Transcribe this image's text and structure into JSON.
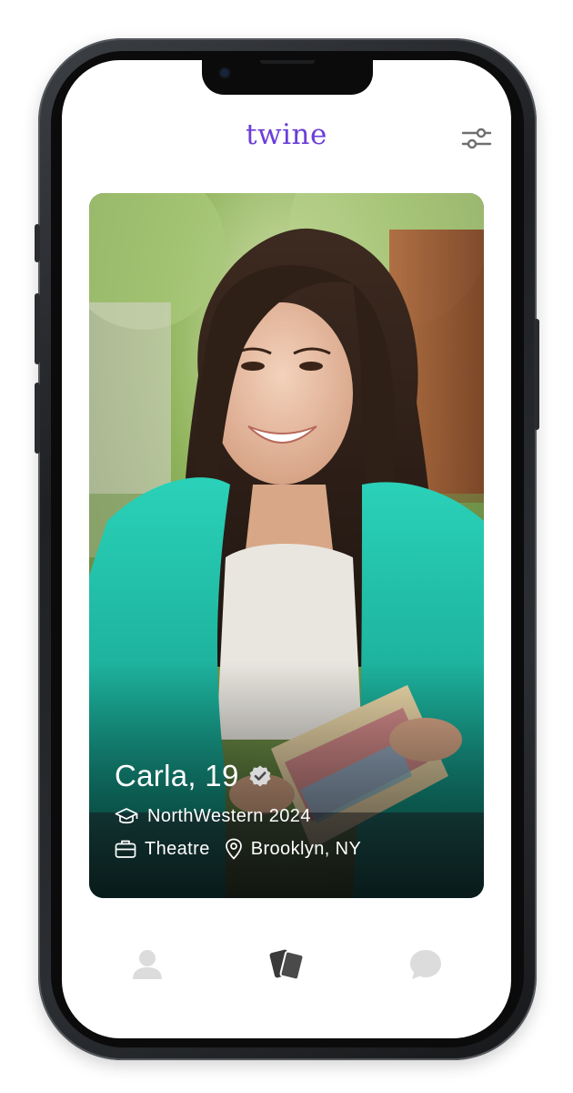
{
  "app": {
    "brand": "twine"
  },
  "profile": {
    "name_age": "Carla, 19",
    "verified": true,
    "school": "NorthWestern 2024",
    "interest": "Theatre",
    "location": "Brooklyn, NY"
  },
  "icons": {
    "filter": "sliders-icon",
    "verified": "check-badge-icon",
    "school": "graduation-cap-icon",
    "interest": "briefcase-icon",
    "location": "map-pin-icon",
    "nav_profile": "person-icon",
    "nav_cards": "cards-icon",
    "nav_chat": "chat-bubble-icon"
  },
  "colors": {
    "brand": "#6b3fd6",
    "nav_inactive": "#dcdcdc",
    "nav_active": "#3a3a3a"
  },
  "nav": {
    "active": "cards"
  }
}
